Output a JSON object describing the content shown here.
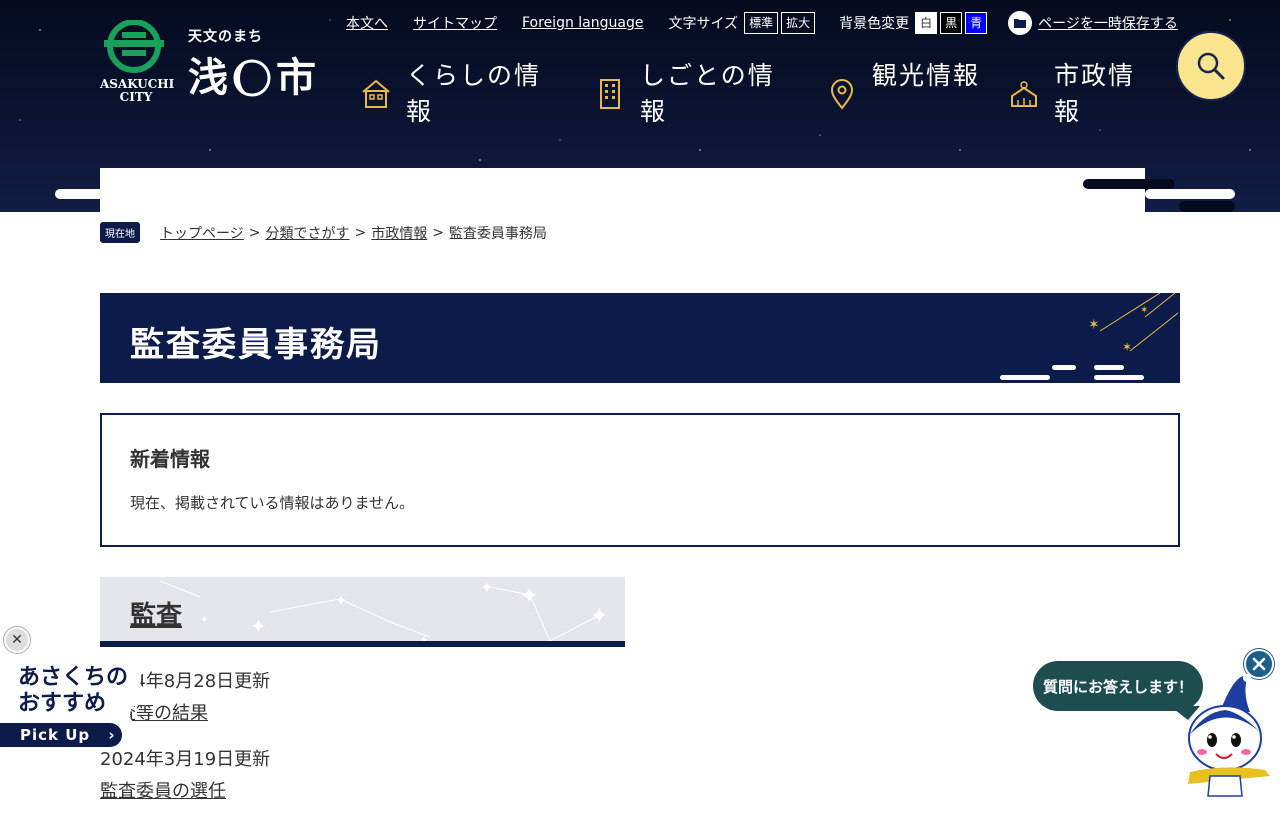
{
  "header": {
    "logo": {
      "city_en": "ASAKUCHI CITY",
      "tagline": "天文のまち",
      "name_part1": "浅",
      "name_part2": "市"
    },
    "utility_links": [
      "本文へ",
      "サイトマップ",
      "Foreign language"
    ],
    "font_size": {
      "label": "文字サイズ",
      "options": [
        "標準",
        "拡大"
      ]
    },
    "bg_color": {
      "label": "背景色変更",
      "options": [
        "白",
        "黒",
        "青"
      ]
    },
    "save_page": "ページを一時保存する",
    "nav": [
      {
        "label": "くらしの情報",
        "icon": "house-icon"
      },
      {
        "label": "しごとの情報",
        "icon": "building-icon"
      },
      {
        "label": "観光情報",
        "icon": "map-pin-icon"
      },
      {
        "label": "市政情報",
        "icon": "city-hall-icon"
      }
    ],
    "search_icon": "search-icon",
    "colors": {
      "navy": "#0d1b4b",
      "gold": "#e8b94a",
      "search_bg": "#f8e58e"
    }
  },
  "breadcrumb": {
    "here": "現在地",
    "items": [
      "トップページ",
      "分類でさがす",
      "市政情報"
    ],
    "current": "監査委員事務局"
  },
  "page": {
    "title": "監査委員事務局",
    "news": {
      "heading": "新着情報",
      "empty": "現在、掲載されている情報はありません。"
    },
    "category": {
      "heading": "監査",
      "items": [
        {
          "date": "2024年8月28日更新",
          "title": "監査等の結果"
        },
        {
          "date": "2024年3月19日更新",
          "title": "監査委員の選任"
        }
      ]
    }
  },
  "pickup": {
    "line1": "あさくちの",
    "line2": "おすすめ",
    "button": "Pick Up"
  },
  "chat": {
    "bubble": "質問にお答えします！"
  }
}
